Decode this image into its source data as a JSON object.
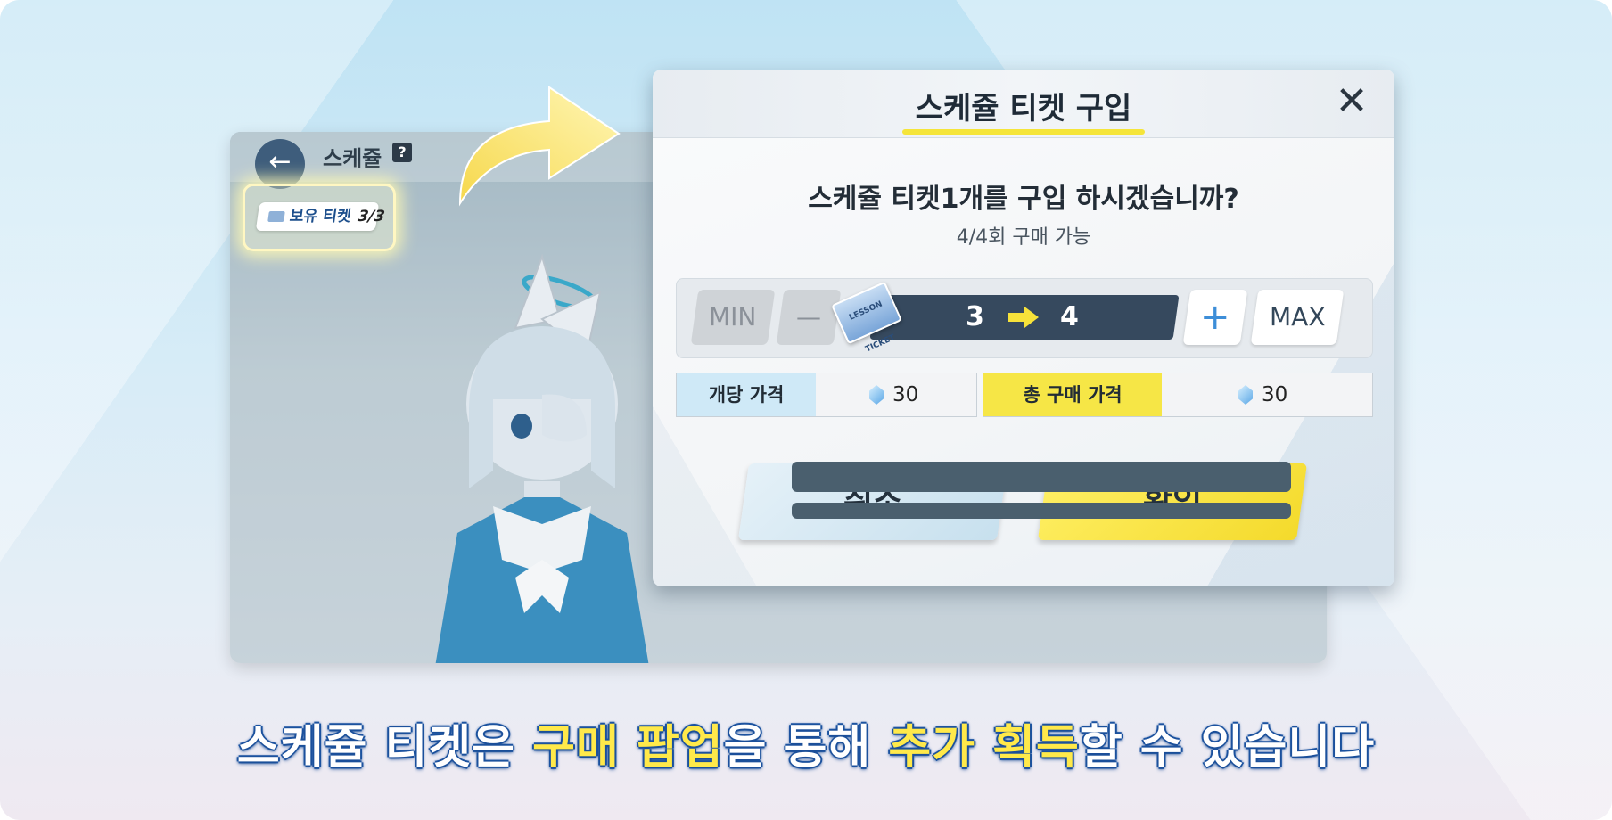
{
  "background_screen": {
    "title": "스케쥴",
    "help_label": "?",
    "back_label": "←",
    "ticket_label": "보유 티켓",
    "ticket_value": "3/3"
  },
  "dialog": {
    "title": "스케쥴 티켓 구입",
    "close_label": "✕",
    "question": "스케쥴 티켓1개를 구입 하시겠습니까?",
    "purchase_limit": "4/4회 구매 가능",
    "quantity": {
      "min_label": "MIN",
      "minus_label": "—",
      "from": "3",
      "to": "4",
      "plus_label": "+",
      "max_label": "MAX",
      "ticket_icon_text": "LESSON TICKET"
    },
    "unit_price": {
      "label": "개당 가격",
      "value": "30"
    },
    "total_price": {
      "label": "총 구매 가격",
      "value": "30"
    },
    "cancel_label": "취소",
    "confirm_label": "확인"
  },
  "caption": {
    "part1": "스케쥴 티켓은 ",
    "hl1": "구매 팝업",
    "part2": "을 통해 ",
    "hl2": "추가 획득",
    "part3": "할 수 있습니다"
  },
  "colors": {
    "accent_yellow": "#f5e53a",
    "confirm_yellow": "#f4da2b",
    "navy": "#36495e",
    "caption_outline": "#1f58a8"
  }
}
